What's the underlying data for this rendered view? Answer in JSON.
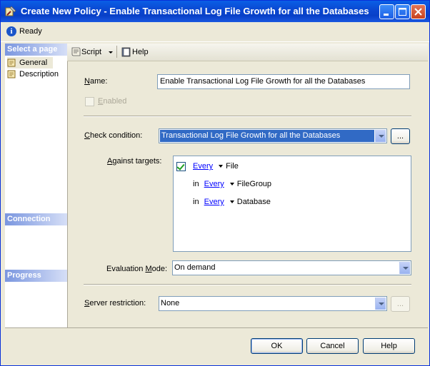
{
  "window": {
    "title": "Create New Policy - Enable Transactional Log File Growth for all the Databases"
  },
  "status": {
    "text": "Ready"
  },
  "left_pane": {
    "select_page_header": "Select a page",
    "pages": [
      "General",
      "Description"
    ],
    "connection_header": "Connection",
    "progress_header": "Progress"
  },
  "toolbar": {
    "script_label": "Script",
    "help_label": "Help"
  },
  "form": {
    "name_label_rest": "ame:",
    "name_label_key": "N",
    "name_value": "Enable Transactional Log File Growth for all the Databases",
    "enabled_label_key": "E",
    "enabled_label_rest": "nabled",
    "check_condition_label_key": "C",
    "check_condition_label_rest": "heck condition:",
    "check_condition_value": "Transactional Log File Growth for all the Databases",
    "browse_label": "...",
    "against_targets_label_key": "A",
    "against_targets_label_rest": "gainst targets:",
    "targets": [
      {
        "prefix": "",
        "quantifier": "Every",
        "type": "File"
      },
      {
        "prefix": "in",
        "quantifier": "Every",
        "type": "FileGroup"
      },
      {
        "prefix": "in",
        "quantifier": "Every",
        "type": "Database"
      }
    ],
    "evaluation_mode_label_pre": "Evaluation ",
    "evaluation_mode_label_key": "M",
    "evaluation_mode_label_rest": "ode:",
    "evaluation_mode_value": "On demand",
    "server_restriction_label_key": "S",
    "server_restriction_label_rest": "erver restriction:",
    "server_restriction_value": "None",
    "server_restriction_browse": "..."
  },
  "buttons": {
    "ok": "OK",
    "cancel": "Cancel",
    "help": "Help"
  }
}
